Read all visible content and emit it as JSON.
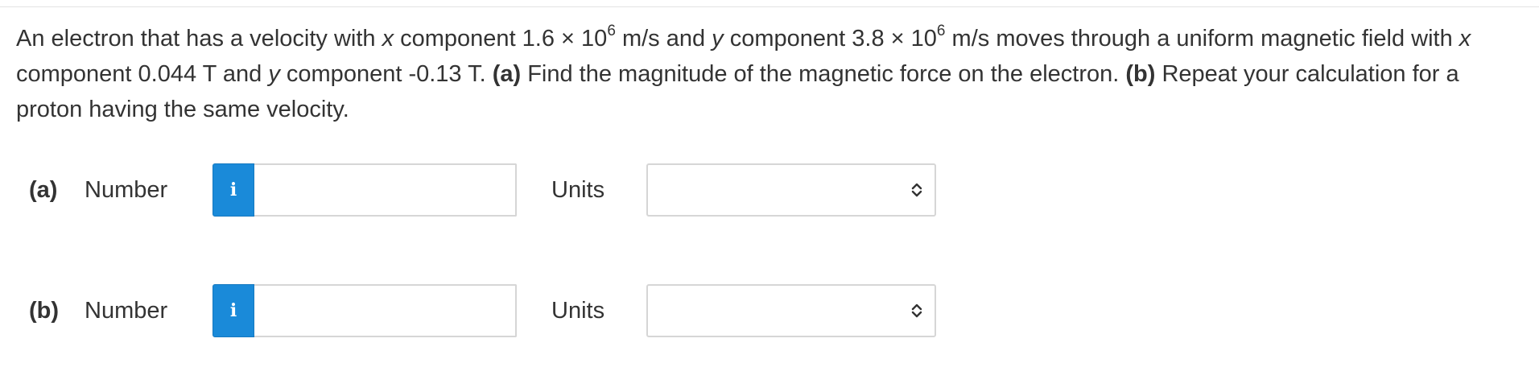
{
  "question": {
    "text_1": "An electron that has a velocity with ",
    "var_x1": "x",
    "text_2": " component 1.6 × 10",
    "exp_1": "6",
    "text_3": " m/s and ",
    "var_y1": "y",
    "text_4": " component 3.8 × 10",
    "exp_2": "6",
    "text_5": " m/s moves through a uniform magnetic field with ",
    "var_x2": "x",
    "text_6": " component 0.044 T and ",
    "var_y2": "y",
    "text_7": " component -0.13 T. ",
    "part_a_tag": "(a)",
    "part_a_text": " Find the magnitude of the magnetic force on the electron. ",
    "part_b_tag": "(b)",
    "part_b_text": " Repeat your calculation for a proton having the same velocity."
  },
  "answers": [
    {
      "part": "(a)",
      "number_label": "Number",
      "info_glyph": "i",
      "info_icon": "info-icon",
      "number_value": "",
      "units_label": "Units",
      "units_value": "",
      "select_icon": "chevron-up-down-icon"
    },
    {
      "part": "(b)",
      "number_label": "Number",
      "info_glyph": "i",
      "info_icon": "info-icon",
      "number_value": "",
      "units_label": "Units",
      "units_value": "",
      "select_icon": "chevron-up-down-icon"
    }
  ],
  "colors": {
    "info_button": "#1a8ad9",
    "text": "#333333",
    "border": "#d6d6d6"
  }
}
